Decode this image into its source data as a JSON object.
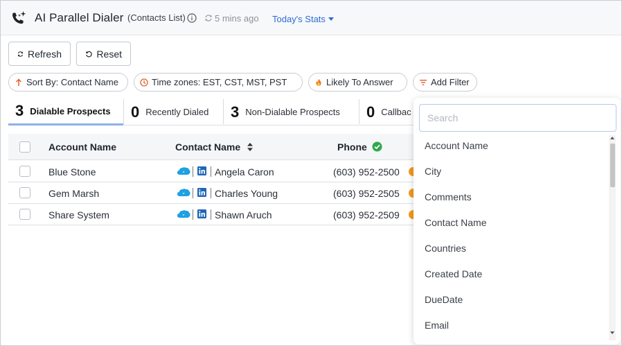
{
  "header": {
    "title": "AI Parallel Dialer",
    "subtitle": "(Contacts List)",
    "sync_text": "5 mins ago",
    "stats_link": "Today's Stats"
  },
  "toolbar": {
    "refresh_label": "Refresh",
    "reset_label": "Reset"
  },
  "filters": {
    "sort": "Sort By: Contact Name",
    "timezones": "Time zones: EST, CST, MST, PST",
    "likely": "Likely To Answer",
    "add_filter": "Add Filter"
  },
  "tabs": [
    {
      "count": "3",
      "label": "Dialable Prospects"
    },
    {
      "count": "0",
      "label": "Recently Dialed"
    },
    {
      "count": "3",
      "label": "Non-Dialable Prospects"
    },
    {
      "count": "0",
      "label": "Callbac"
    }
  ],
  "table": {
    "columns": [
      "Account Name",
      "Contact Name",
      "Phone"
    ],
    "rows": [
      {
        "account": "Blue Stone",
        "contact": "Angela Caron",
        "phone": "(603) 952-2500"
      },
      {
        "account": "Gem Marsh",
        "contact": "Charles Young",
        "phone": "(603) 952-2505"
      },
      {
        "account": "Share System",
        "contact": "Shawn Aruch",
        "phone": "(603) 952-2509"
      }
    ]
  },
  "dropdown": {
    "search_placeholder": "Search",
    "items": [
      "Account Name",
      "City",
      "Comments",
      "Contact Name",
      "Countries",
      "Created Date",
      "DueDate",
      "Email"
    ]
  },
  "colors": {
    "accent": "#2d6bd6",
    "tab_underline": "#8fb0e8",
    "salesforce": "#1ea1e2",
    "linkedin": "#1f66b4",
    "phone_verified": "#2fa84f",
    "timezone_icon": "#e2612d"
  },
  "icons": [
    "phone-sparkle-icon",
    "info-icon",
    "sync-icon",
    "caret-down-icon",
    "refresh-icon",
    "reset-icon",
    "arrow-up-icon",
    "clock-icon",
    "fire-icon",
    "filter-icon",
    "sort-icon",
    "check-circle-icon",
    "salesforce-icon",
    "linkedin-icon"
  ]
}
